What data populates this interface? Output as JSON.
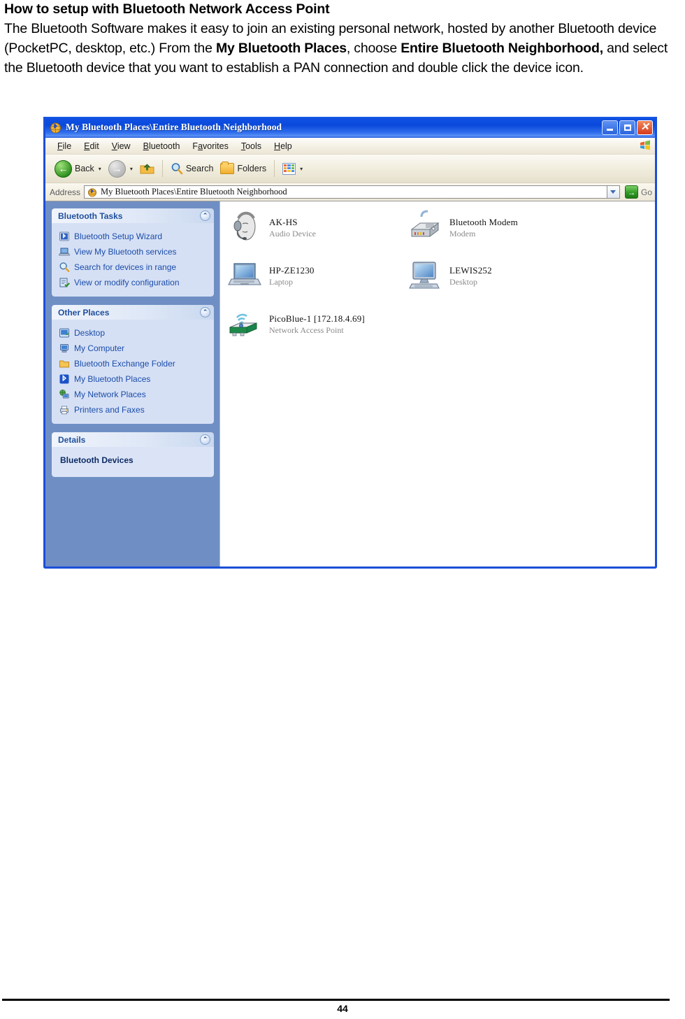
{
  "document": {
    "heading": "How to setup with Bluetooth Network Access Point",
    "paragraph": {
      "seg1": "The Bluetooth Software makes it easy to join an existing personal network, hosted by another Bluetooth device (PocketPC, desktop, etc.) From the ",
      "bold1": "My Bluetooth Places",
      "seg2": ", choose ",
      "bold2": "Entire Bluetooth Neighborhood,",
      "seg3": " and select the Bluetooth device that you want to establish a PAN connection and double click the device icon."
    },
    "page_number": "44"
  },
  "window": {
    "title": "My Bluetooth Places\\Entire Bluetooth Neighborhood",
    "title_icon": "bluetooth-globe-icon",
    "controls": {
      "minimize": "minimize-icon",
      "maximize": "maximize-icon",
      "close": "close-icon"
    },
    "menu": [
      {
        "pre": "",
        "accel": "F",
        "post": "ile"
      },
      {
        "pre": "",
        "accel": "E",
        "post": "dit"
      },
      {
        "pre": "",
        "accel": "V",
        "post": "iew"
      },
      {
        "pre": "",
        "accel": "B",
        "post": "luetooth"
      },
      {
        "pre": "F",
        "accel": "a",
        "post": "vorites"
      },
      {
        "pre": "",
        "accel": "T",
        "post": "ools"
      },
      {
        "pre": "",
        "accel": "H",
        "post": "elp"
      }
    ],
    "toolbar": {
      "back_label": "Back",
      "forward_label": "",
      "up_label": "",
      "search_label": "Search",
      "folders_label": "Folders",
      "views_label": ""
    },
    "address": {
      "label": "Address",
      "value": "My Bluetooth Places\\Entire Bluetooth Neighborhood",
      "go_label": "Go"
    },
    "sidebar": {
      "panels": [
        {
          "title": "Bluetooth Tasks",
          "items": [
            {
              "label": "Bluetooth Setup Wizard",
              "icon": "bluetooth-wizard-icon"
            },
            {
              "label": "View My Bluetooth services",
              "icon": "laptop-services-icon"
            },
            {
              "label": "Search for devices in range",
              "icon": "magnifier-icon"
            },
            {
              "label": "View or modify configuration",
              "icon": "configuration-icon"
            }
          ]
        },
        {
          "title": "Other Places",
          "items": [
            {
              "label": "Desktop",
              "icon": "desktop-icon"
            },
            {
              "label": "My Computer",
              "icon": "my-computer-icon"
            },
            {
              "label": "Bluetooth Exchange Folder",
              "icon": "folder-icon"
            },
            {
              "label": "My Bluetooth Places",
              "icon": "bluetooth-places-icon"
            },
            {
              "label": "My Network Places",
              "icon": "network-places-icon"
            },
            {
              "label": "Printers and Faxes",
              "icon": "printers-faxes-icon"
            }
          ]
        },
        {
          "title": "Details",
          "detail_text": "Bluetooth Devices"
        }
      ]
    },
    "devices": [
      {
        "name": "AK-HS",
        "type": "Audio Device",
        "icon": "headset-icon"
      },
      {
        "name": "Bluetooth Modem",
        "type": "Modem",
        "icon": "modem-icon"
      },
      {
        "name": "HP-ZE1230",
        "type": "Laptop",
        "icon": "laptop-icon"
      },
      {
        "name": "LEWIS252",
        "type": "Desktop",
        "icon": "desktop-computer-icon"
      },
      {
        "name": "PicoBlue-1 [172.18.4.69]",
        "type": "Network Access Point",
        "icon": "network-access-point-icon"
      }
    ]
  },
  "colors": {
    "titlebar_blue": "#0a49db",
    "window_border": "#1c4fd8",
    "sidebar_bg": "#6f8fc4",
    "panel_body": "#d6e0f5",
    "panel_title": "#1f4f9c",
    "link_blue": "#1a4da8",
    "device_type_grey": "#8a8a8a"
  }
}
